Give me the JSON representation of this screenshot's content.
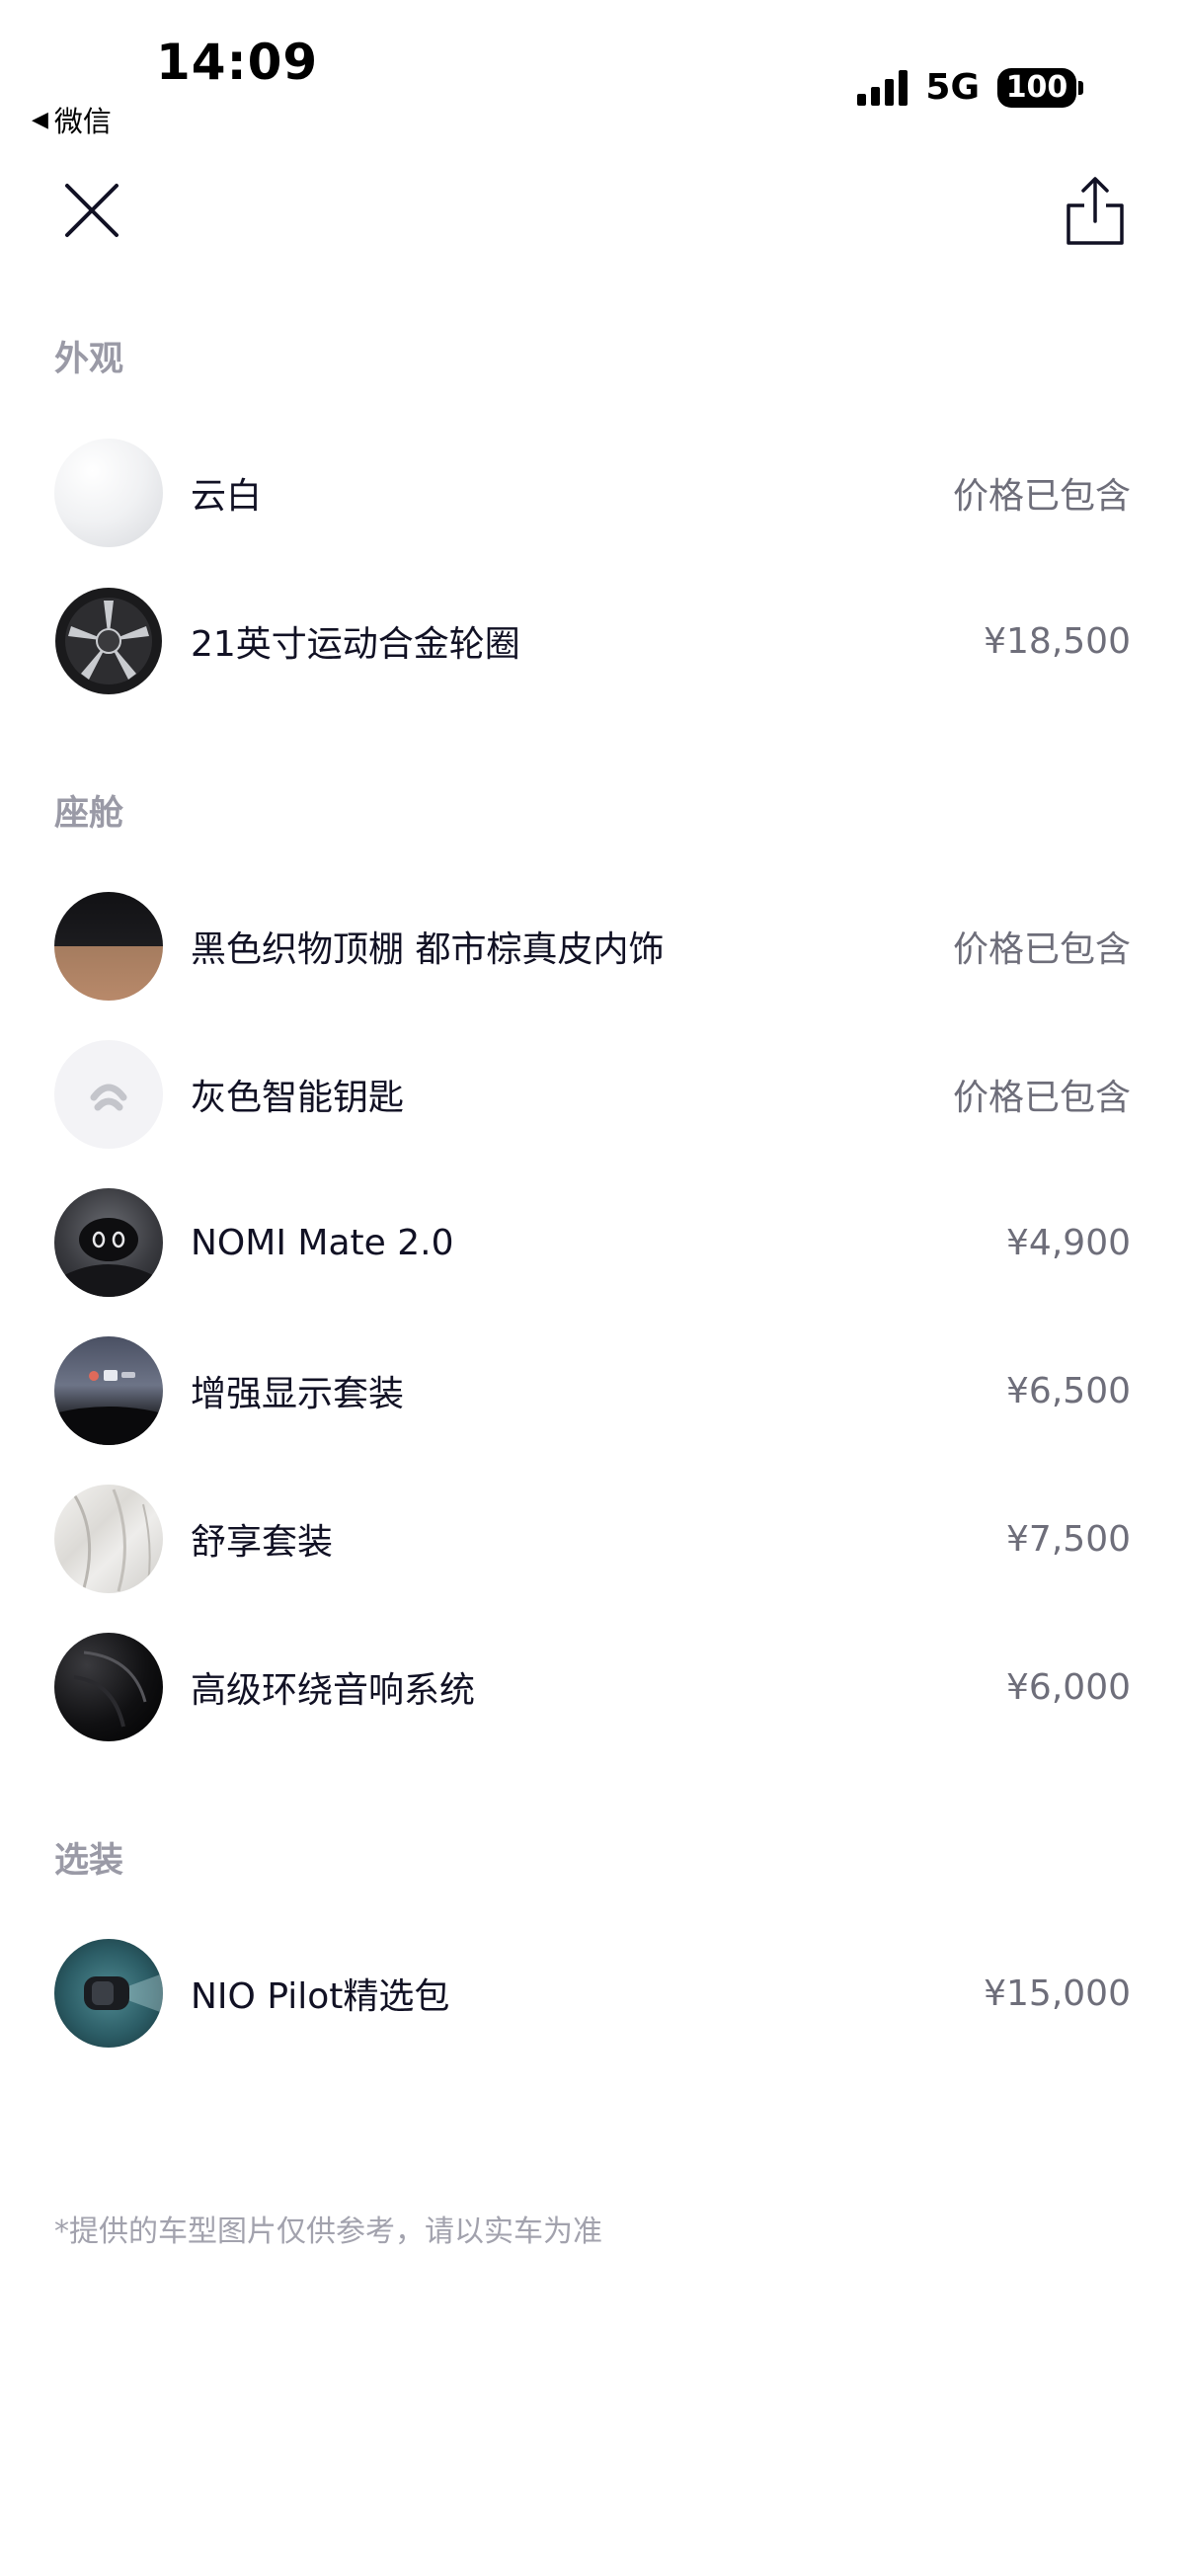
{
  "status_bar": {
    "time": "14:09",
    "back_app": "微信",
    "network": "5G",
    "battery": "100"
  },
  "toolbar": {
    "close_icon": "close-icon",
    "share_icon": "share-icon"
  },
  "sections": [
    {
      "title": "外观",
      "items": [
        {
          "label": "云白",
          "price": "价格已包含",
          "thumb": "white-paint-swatch"
        },
        {
          "label": "21英寸运动合金轮圈",
          "price": "¥18,500",
          "thumb": "alloy-wheel"
        }
      ]
    },
    {
      "title": "座舱",
      "items": [
        {
          "label": "黑色织物顶棚 都市棕真皮内饰",
          "price": "价格已包含",
          "thumb": "interior-swatch"
        },
        {
          "label": "灰色智能钥匙",
          "price": "价格已包含",
          "thumb": "smart-key"
        },
        {
          "label": "NOMI Mate 2.0",
          "price": "¥4,900",
          "thumb": "nomi-robot"
        },
        {
          "label": "增强显示套装",
          "price": "¥6,500",
          "thumb": "hud-display"
        },
        {
          "label": "舒享套装",
          "price": "¥7,500",
          "thumb": "seat-comfort"
        },
        {
          "label": "高级环绕音响系统",
          "price": "¥6,000",
          "thumb": "speaker"
        }
      ]
    },
    {
      "title": "选装",
      "items": [
        {
          "label": "NIO Pilot精选包",
          "price": "¥15,000",
          "thumb": "car-pilot"
        }
      ]
    }
  ],
  "footer_note": "*提供的车型图片仅供参考，请以实车为准",
  "colors": {
    "text_primary": "#111124",
    "text_secondary": "#6e6e7a",
    "section_title": "#9a9aa6",
    "background": "#ffffff"
  }
}
